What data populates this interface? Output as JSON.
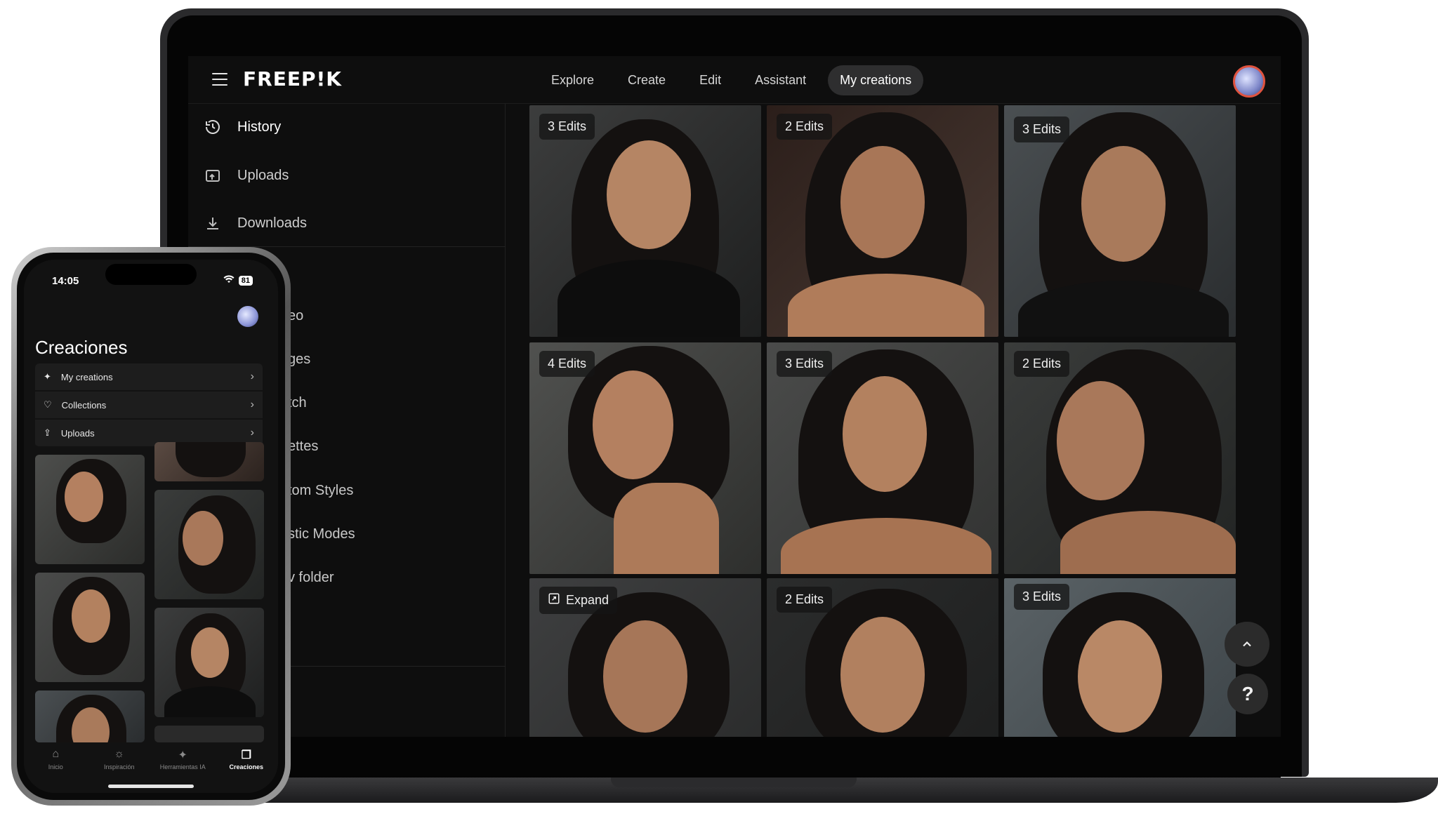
{
  "app": {
    "logo": "FREEP!K"
  },
  "nav": {
    "items": [
      "Explore",
      "Create",
      "Edit",
      "Assistant",
      "My creations"
    ],
    "active": "My creations"
  },
  "sidebar": {
    "items": [
      {
        "label": "History",
        "icon": "history-icon"
      },
      {
        "label": "Uploads",
        "icon": "uploads-icon"
      },
      {
        "label": "Downloads",
        "icon": "download-icon"
      }
    ],
    "partial_items": [
      "eo",
      "ges",
      "tch",
      "ettes",
      "tom Styles",
      "stic Modes",
      "v folder"
    ]
  },
  "grid": {
    "cards": [
      {
        "badge": "3 Edits"
      },
      {
        "badge": "2 Edits"
      },
      {
        "badge": "3 Edits"
      },
      {
        "badge": "4 Edits"
      },
      {
        "badge": "3 Edits"
      },
      {
        "badge": "2 Edits"
      },
      {
        "badge": "Expand",
        "icon": "expand-icon"
      },
      {
        "badge": "2 Edits"
      },
      {
        "badge": "3 Edits"
      }
    ]
  },
  "fabs": {
    "scroll_top": "⌃",
    "help": "?"
  },
  "phone": {
    "time": "14:05",
    "battery": "81",
    "title": "Creaciones",
    "menu": [
      {
        "label": "My creations",
        "icon": "sparkle-icon"
      },
      {
        "label": "Collections",
        "icon": "heart-icon"
      },
      {
        "label": "Uploads",
        "icon": "upload-icon"
      }
    ],
    "tabs": [
      {
        "label": "Inicio",
        "icon": "home-icon",
        "glyph": "⌂"
      },
      {
        "label": "Inspiración",
        "icon": "lightbulb-icon",
        "glyph": "☼"
      },
      {
        "label": "Herramientas IA",
        "icon": "sparkle-icon",
        "glyph": "✦"
      },
      {
        "label": "Creaciones",
        "icon": "folder-icon",
        "glyph": "❐"
      }
    ],
    "active_tab": "Creaciones"
  },
  "colors": {
    "accent_avatar_ring": "#e0533f",
    "nav_active_bg": "#2e2e2f"
  }
}
